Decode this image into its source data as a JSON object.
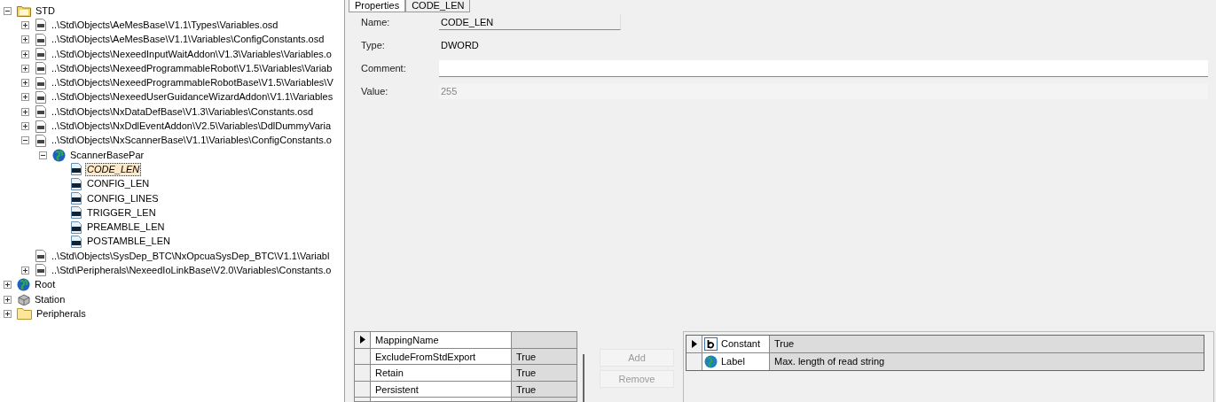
{
  "tree": [
    {
      "label": "STD",
      "kind": "library",
      "expanded": true,
      "selected": false,
      "children": [
        {
          "label": "..\\Std\\Objects\\AeMesBase\\V1.1\\Types\\Variables.osd",
          "kind": "file",
          "expanded": false,
          "selected": false
        },
        {
          "label": "..\\Std\\Objects\\AeMesBase\\V1.1\\Variables\\ConfigConstants.osd",
          "kind": "file",
          "expanded": false,
          "selected": false
        },
        {
          "label": "..\\Std\\Objects\\NexeedInputWaitAddon\\V1.3\\Variables\\Variables.o",
          "kind": "file",
          "expanded": false,
          "selected": false
        },
        {
          "label": "..\\Std\\Objects\\NexeedProgrammableRobot\\V1.5\\Variables\\Variab",
          "kind": "file",
          "expanded": false,
          "selected": false
        },
        {
          "label": "..\\Std\\Objects\\NexeedProgrammableRobotBase\\V1.5\\Variables\\V",
          "kind": "file",
          "expanded": false,
          "selected": false
        },
        {
          "label": "..\\Std\\Objects\\NexeedUserGuidanceWizardAddon\\V1.1\\Variables",
          "kind": "file",
          "expanded": false,
          "selected": false
        },
        {
          "label": "..\\Std\\Objects\\NxDataDefBase\\V1.3\\Variables\\Constants.osd",
          "kind": "file",
          "expanded": false,
          "selected": false
        },
        {
          "label": "..\\Std\\Objects\\NxDdlEventAddon\\V2.5\\Variables\\DdlDummyVaria",
          "kind": "file",
          "expanded": false,
          "selected": false
        },
        {
          "label": "..\\Std\\Objects\\NxScannerBase\\V1.1\\Variables\\ConfigConstants.o",
          "kind": "file",
          "expanded": true,
          "selected": false,
          "children": [
            {
              "label": "ScannerBasePar",
              "kind": "group",
              "expanded": true,
              "selected": false,
              "children": [
                {
                  "label": "CODE_LEN",
                  "kind": "variable",
                  "selected": true
                },
                {
                  "label": "CONFIG_LEN",
                  "kind": "variable",
                  "selected": false
                },
                {
                  "label": "CONFIG_LINES",
                  "kind": "variable",
                  "selected": false
                },
                {
                  "label": "TRIGGER_LEN",
                  "kind": "variable",
                  "selected": false
                },
                {
                  "label": "PREAMBLE_LEN",
                  "kind": "variable",
                  "selected": false
                },
                {
                  "label": "POSTAMBLE_LEN",
                  "kind": "variable",
                  "selected": false
                }
              ]
            }
          ]
        },
        {
          "label": "..\\Std\\Objects\\SysDep_BTC\\NxOpcuaSysDep_BTC\\V1.1\\Variabl",
          "kind": "file",
          "selected": false
        },
        {
          "label": "..\\Std\\Peripherals\\NexeedIoLinkBase\\V2.0\\Variables\\Constants.o",
          "kind": "file",
          "expanded": false,
          "selected": false
        }
      ]
    },
    {
      "label": "Root",
      "kind": "group",
      "expanded": false,
      "selected": false
    },
    {
      "label": "Station",
      "kind": "station",
      "expanded": false,
      "selected": false
    },
    {
      "label": "Peripherals",
      "kind": "folder",
      "expanded": false,
      "selected": false
    }
  ],
  "tabs": [
    {
      "label": "Properties",
      "selected": true
    },
    {
      "label": "CODE_LEN",
      "selected": false
    }
  ],
  "fields": [
    {
      "label": "Name:",
      "kind": "readonly",
      "value": "CODE_LEN"
    },
    {
      "label": "Type:",
      "kind": "text",
      "value": "DWORD"
    },
    {
      "label": "Comment:",
      "kind": "input"
    },
    {
      "label": "Value:",
      "kind": "disabled",
      "value": "255"
    }
  ],
  "mapping_grid": {
    "rows": [
      {
        "name": "MappingName",
        "selected": true
      },
      {
        "name": "ExcludeFromStdExport",
        "value": "True",
        "selected": false
      },
      {
        "name": "Retain",
        "value": "True",
        "selected": false
      },
      {
        "name": "Persistent",
        "value": "True",
        "selected": false
      }
    ]
  },
  "buttons": [
    {
      "label": "Add",
      "disabled": true
    },
    {
      "label": "Remove",
      "disabled": true
    }
  ],
  "attribute_grid": {
    "rows": [
      {
        "name": "Constant",
        "kind": "boolean",
        "value": "True",
        "selected": true
      },
      {
        "name": "Label",
        "kind": "text",
        "value": "Max. length of read string",
        "selected": false
      }
    ]
  }
}
